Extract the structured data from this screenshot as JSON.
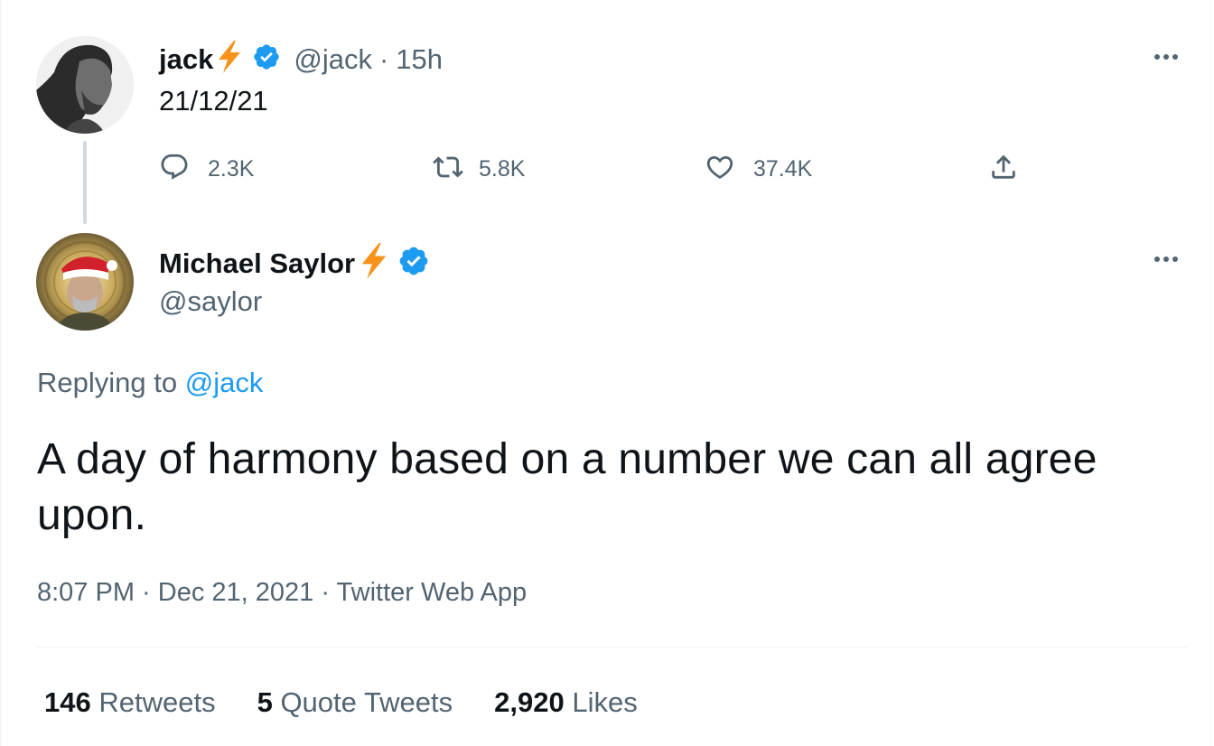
{
  "colors": {
    "text": "#0f1419",
    "secondary": "#536471",
    "accent": "#1d9bf0",
    "bolt": "#f7931a",
    "divider": "#eff3f4"
  },
  "parent_tweet": {
    "name": "jack",
    "badge_icon": "lightning-icon",
    "verified_icon": "verified-badge-icon",
    "handle": "@jack",
    "separator": "·",
    "time": "15h",
    "text": "21/12/21",
    "actions": {
      "reply_count": "2.3K",
      "retweet_count": "5.8K",
      "like_count": "37.4K"
    }
  },
  "reply_tweet": {
    "name": "Michael Saylor",
    "badge_icon": "lightning-icon",
    "verified_icon": "verified-badge-icon",
    "handle": "@saylor",
    "replying_label": "Replying to",
    "replying_mention": "@jack",
    "text": "A day of harmony based on a number we can all agree upon.",
    "meta": "8:07 PM · Dec 21, 2021 · Twitter Web App",
    "stats": [
      {
        "count": "146",
        "label": "Retweets"
      },
      {
        "count": "5",
        "label": "Quote Tweets"
      },
      {
        "count": "2,920",
        "label": "Likes"
      }
    ]
  }
}
